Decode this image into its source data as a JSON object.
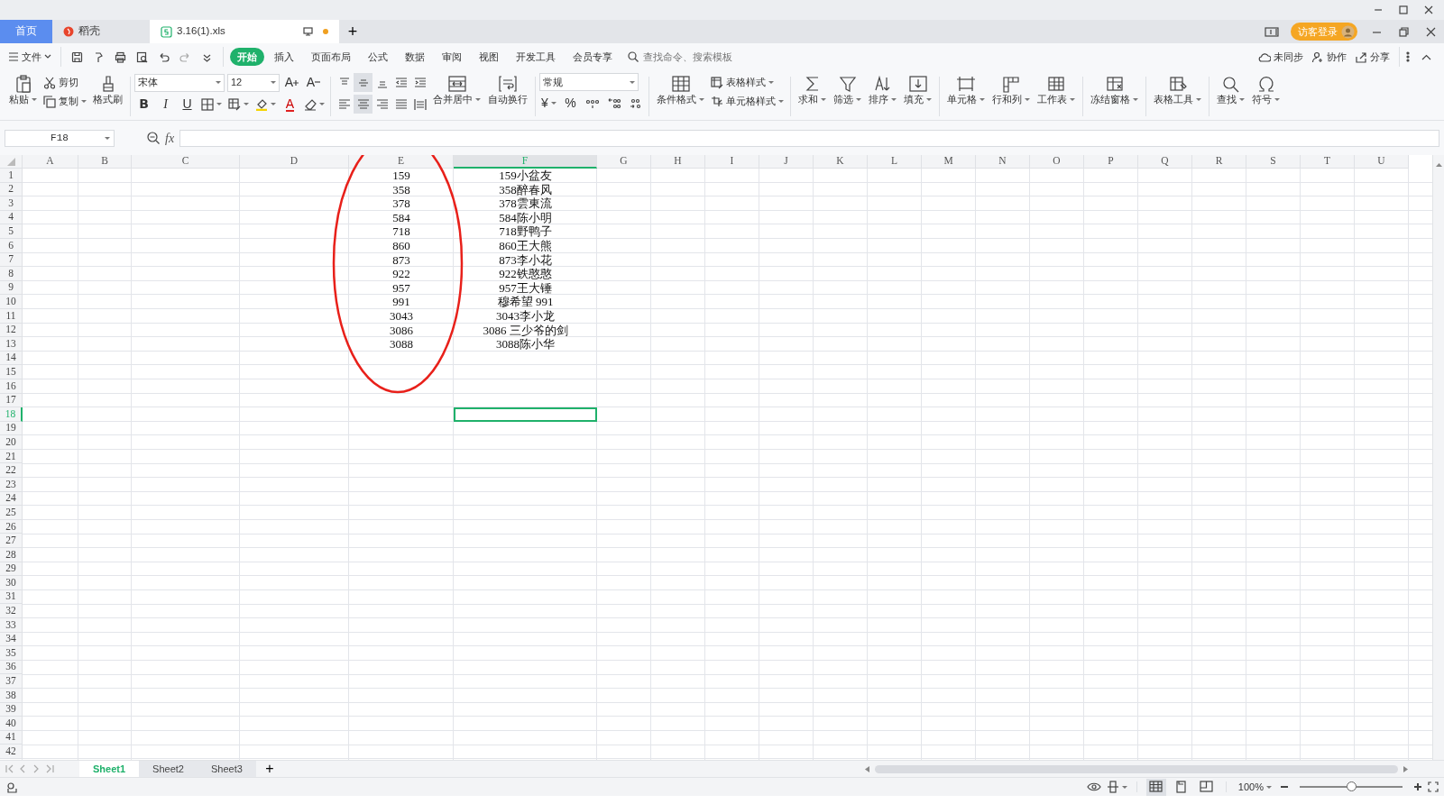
{
  "window": {
    "doc_tabs": [
      {
        "label": "首页",
        "kind": "home",
        "selected": false
      },
      {
        "label": "稻壳",
        "kind": "docer",
        "selected": false
      },
      {
        "label": "3.16(1).xls",
        "kind": "file",
        "selected": true,
        "unsaved": true
      }
    ],
    "add_tab": "+",
    "login": "访客登录"
  },
  "menu": {
    "file": "文件",
    "tabs": [
      {
        "label": "开始",
        "selected": true
      },
      {
        "label": "插入",
        "selected": false
      },
      {
        "label": "页面布局",
        "selected": false
      },
      {
        "label": "公式",
        "selected": false
      },
      {
        "label": "数据",
        "selected": false
      },
      {
        "label": "审阅",
        "selected": false
      },
      {
        "label": "视图",
        "selected": false
      },
      {
        "label": "开发工具",
        "selected": false
      },
      {
        "label": "会员专享",
        "selected": false
      }
    ],
    "search": {
      "placeholder": "查找命令、搜索模板"
    },
    "actions": [
      "未同步",
      "协作",
      "分享"
    ]
  },
  "toolbar": {
    "paste": {
      "label": "粘贴",
      "dropdown": true
    },
    "cut": {
      "label": "剪切",
      "dropdown": false
    },
    "copy": {
      "label": "复制",
      "dropdown": true
    },
    "format_painter": {
      "label": "格式刷",
      "dropdown": false
    },
    "font": {
      "name": "宋体",
      "size": "12",
      "grow": "A",
      "shrink": "A",
      "bold": "B",
      "italic": "I",
      "underline": "U",
      "font_color": "A"
    },
    "align_buttons": [
      {
        "selected": false
      },
      {
        "selected": true
      },
      {
        "selected": false
      },
      {
        "selected": false
      },
      {
        "selected": false
      },
      {
        "selected": false
      },
      {
        "selected": true
      },
      {
        "selected": false
      },
      {
        "selected": false
      },
      {
        "selected": false
      }
    ],
    "merge": {
      "label": "合并居中",
      "dropdown": true
    },
    "wrap": {
      "label": "自动换行",
      "dropdown": false
    },
    "number": {
      "format": "常规",
      "currency": "¥",
      "percent": "%"
    },
    "style_buttons": [
      {
        "label": "表格样式",
        "dropdown": true
      },
      {
        "label": "单元格样式",
        "dropdown": true
      }
    ],
    "big_groups": [
      [
        {
          "label": "条件格式",
          "dropdown": true
        }
      ],
      [
        {
          "label": "求和",
          "dropdown": true
        },
        {
          "label": "筛选",
          "dropdown": true
        },
        {
          "label": "排序",
          "dropdown": true
        },
        {
          "label": "填充",
          "dropdown": true
        }
      ],
      [
        {
          "label": "单元格",
          "dropdown": true
        },
        {
          "label": "行和列",
          "dropdown": true
        },
        {
          "label": "工作表",
          "dropdown": true
        }
      ],
      [
        {
          "label": "冻结窗格",
          "dropdown": true
        }
      ],
      [
        {
          "label": "表格工具",
          "dropdown": true
        }
      ],
      [
        {
          "label": "查找",
          "dropdown": true
        },
        {
          "label": "符号",
          "dropdown": true
        }
      ]
    ]
  },
  "formula_bar": {
    "name_box": "F18",
    "fx": "fx"
  },
  "sheet": {
    "columns": [
      {
        "label": "A",
        "selected": false
      },
      {
        "label": "B",
        "selected": false
      },
      {
        "label": "C",
        "selected": false
      },
      {
        "label": "D",
        "selected": false
      },
      {
        "label": "E",
        "selected": false
      },
      {
        "label": "F",
        "selected": true
      },
      {
        "label": "G",
        "selected": false
      },
      {
        "label": "H",
        "selected": false
      },
      {
        "label": "I",
        "selected": false
      },
      {
        "label": "J",
        "selected": false
      },
      {
        "label": "K",
        "selected": false
      },
      {
        "label": "L",
        "selected": false
      },
      {
        "label": "M",
        "selected": false
      },
      {
        "label": "N",
        "selected": false
      },
      {
        "label": "O",
        "selected": false
      },
      {
        "label": "P",
        "selected": false
      },
      {
        "label": "Q",
        "selected": false
      },
      {
        "label": "R",
        "selected": false
      },
      {
        "label": "S",
        "selected": false
      },
      {
        "label": "T",
        "selected": false
      },
      {
        "label": "U",
        "selected": false
      }
    ],
    "rows": [
      {
        "header": "1",
        "selected": false,
        "cells": {
          "E": "159",
          "F": "159小盆友"
        }
      },
      {
        "header": "2",
        "selected": false,
        "cells": {
          "E": "358",
          "F": "358醉春风"
        }
      },
      {
        "header": "3",
        "selected": false,
        "cells": {
          "E": "378",
          "F": "378雲東流"
        }
      },
      {
        "header": "4",
        "selected": false,
        "cells": {
          "E": "584",
          "F": "584陈小明"
        }
      },
      {
        "header": "5",
        "selected": false,
        "cells": {
          "E": "718",
          "F": "718野鸭子"
        }
      },
      {
        "header": "6",
        "selected": false,
        "cells": {
          "E": "860",
          "F": "860王大熊"
        }
      },
      {
        "header": "7",
        "selected": false,
        "cells": {
          "E": "873",
          "F": "873李小花"
        }
      },
      {
        "header": "8",
        "selected": false,
        "cells": {
          "E": "922",
          "F": "922铁憨憨"
        }
      },
      {
        "header": "9",
        "selected": false,
        "cells": {
          "E": "957",
          "F": "957王大锤"
        }
      },
      {
        "header": "10",
        "selected": false,
        "cells": {
          "E": "991",
          "F": "穆希望 991"
        }
      },
      {
        "header": "11",
        "selected": false,
        "cells": {
          "E": "3043",
          "F": "3043李小龙"
        }
      },
      {
        "header": "12",
        "selected": false,
        "cells": {
          "E": "3086",
          "F": "3086 三少爷的剑"
        }
      },
      {
        "header": "13",
        "selected": false,
        "cells": {
          "E": "3088",
          "F": "3088陈小华"
        }
      },
      {
        "header": "14",
        "selected": false
      },
      {
        "header": "15",
        "selected": false
      },
      {
        "header": "16",
        "selected": false
      },
      {
        "header": "17",
        "selected": false
      },
      {
        "header": "18",
        "selected": true
      },
      {
        "header": "19",
        "selected": false
      },
      {
        "header": "20",
        "selected": false
      },
      {
        "header": "21",
        "selected": false
      },
      {
        "header": "22",
        "selected": false
      },
      {
        "header": "23",
        "selected": false
      },
      {
        "header": "24",
        "selected": false
      },
      {
        "header": "25",
        "selected": false
      },
      {
        "header": "26",
        "selected": false
      },
      {
        "header": "27",
        "selected": false
      },
      {
        "header": "28",
        "selected": false
      },
      {
        "header": "29",
        "selected": false
      },
      {
        "header": "30",
        "selected": false
      },
      {
        "header": "31",
        "selected": false
      },
      {
        "header": "32",
        "selected": false
      },
      {
        "header": "33",
        "selected": false
      },
      {
        "header": "34",
        "selected": false
      },
      {
        "header": "35",
        "selected": false
      },
      {
        "header": "36",
        "selected": false
      },
      {
        "header": "37",
        "selected": false
      },
      {
        "header": "38",
        "selected": false
      },
      {
        "header": "39",
        "selected": false
      },
      {
        "header": "40",
        "selected": false
      },
      {
        "header": "41",
        "selected": false
      },
      {
        "header": "42",
        "selected": false
      }
    ],
    "annotation": {
      "kind": "ellipse"
    }
  },
  "sheet_tabs": [
    {
      "label": "Sheet1",
      "selected": true
    },
    {
      "label": "Sheet2",
      "selected": false
    },
    {
      "label": "Sheet3",
      "selected": false
    }
  ],
  "add_sheet": "+",
  "status_bar": {
    "views": [
      {
        "kind": "normal",
        "selected": true
      },
      {
        "kind": "page",
        "selected": false
      },
      {
        "kind": "break",
        "selected": false
      }
    ],
    "zoom": "100%",
    "zoom_slider": {
      "level": 0.5
    }
  }
}
